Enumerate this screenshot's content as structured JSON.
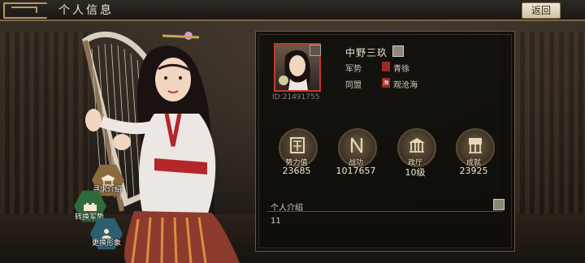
{
  "header": {
    "title": "个人信息",
    "back_label": "返回"
  },
  "side_buttons": [
    {
      "label": "寻求介绍",
      "color": "#8b6a3e"
    },
    {
      "label": "转换军势",
      "color": "#2f6a3a"
    },
    {
      "label": "更换形象",
      "color": "#2d5f73"
    }
  ],
  "profile": {
    "id_text": "ID:21491755",
    "name": "中野三玖",
    "faction_label": "军势",
    "faction_value": "青徐",
    "faction_color": "#9a2a24",
    "alliance_label": "同盟",
    "alliance_flag": "海",
    "alliance_value": "观沧海",
    "alliance_color": "#9a2a24"
  },
  "stats": [
    {
      "label": "势力值",
      "value": "23685"
    },
    {
      "label": "战功",
      "value": "1017657"
    },
    {
      "label": "政厅",
      "value": "10级"
    },
    {
      "label": "成就",
      "value": "23925"
    }
  ],
  "intro": {
    "title": "个人介绍",
    "text": "11"
  },
  "colors": {
    "accent_gold": "#b79a63",
    "panel_bg": "#0e0c0a",
    "avatar_border": "#c23a2c"
  }
}
